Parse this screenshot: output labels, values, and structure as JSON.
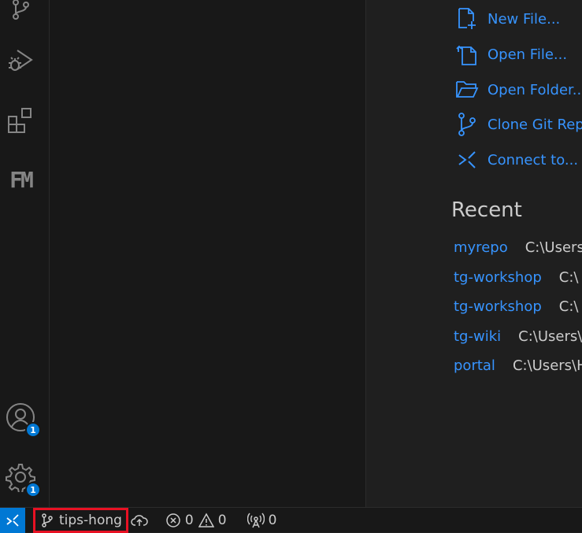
{
  "activity_bar": {
    "accounts_badge": "1",
    "manage_badge": "1",
    "fm_label": "FM"
  },
  "start": {
    "items": [
      {
        "label": "New File...",
        "icon": "new-file-icon"
      },
      {
        "label": "Open File...",
        "icon": "open-file-icon"
      },
      {
        "label": "Open Folder...",
        "icon": "open-folder-icon"
      },
      {
        "label": "Clone Git Repository...",
        "icon": "git-branch-icon"
      },
      {
        "label": "Connect to...",
        "icon": "remote-icon"
      }
    ]
  },
  "recent": {
    "title": "Recent",
    "items": [
      {
        "name": "myrepo",
        "path": "C:\\Users"
      },
      {
        "name": "tg-workshop",
        "path": "C:\\"
      },
      {
        "name": "tg-workshop",
        "path": "C:\\"
      },
      {
        "name": "tg-wiki",
        "path": "C:\\Users\\"
      },
      {
        "name": "portal",
        "path": "C:\\Users\\H"
      }
    ]
  },
  "statusbar": {
    "branch": "tips-hong",
    "errors": "0",
    "warnings": "0",
    "ports": "0"
  },
  "colors": {
    "accent": "#0078d4",
    "link": "#3794ff",
    "highlight_border": "#e81123"
  }
}
